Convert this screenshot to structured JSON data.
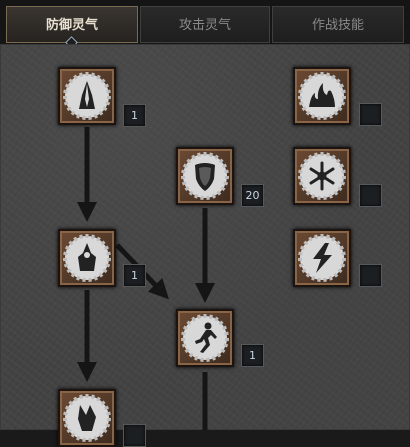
{
  "tabs": [
    {
      "label": "防御灵气",
      "active": true
    },
    {
      "label": "攻击灵气",
      "active": false
    },
    {
      "label": "作战技能",
      "active": false
    }
  ],
  "skills": [
    {
      "name": "skill-prayer",
      "icon": "praying-hands-icon",
      "rank": "1"
    },
    {
      "name": "skill-resist-fire",
      "icon": "flame-icon",
      "rank": ""
    },
    {
      "name": "skill-defiance",
      "icon": "shield-icon",
      "rank": "20"
    },
    {
      "name": "skill-resist-cold",
      "icon": "snowflake-icon",
      "rank": ""
    },
    {
      "name": "skill-cleansing",
      "icon": "hands-up-icon",
      "rank": "1"
    },
    {
      "name": "skill-resist-lightning",
      "icon": "lightning-icon",
      "rank": ""
    },
    {
      "name": "skill-vigor",
      "icon": "running-figure-icon",
      "rank": "1"
    },
    {
      "name": "skill-meditation",
      "icon": "meditation-hands-icon",
      "rank": ""
    }
  ],
  "colors": {
    "frame": "#6b4a33",
    "gear": "#d8d8d8",
    "rank_text": "#c8d4e8",
    "arrow": "#1a1a1a"
  }
}
